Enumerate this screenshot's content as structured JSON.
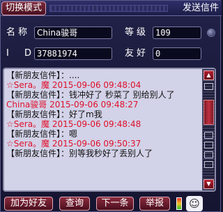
{
  "header": {
    "mode_button": "切换模式",
    "send_label": "发送信件"
  },
  "info": {
    "name_label": "名称",
    "name_value": "China骏哥",
    "level_label": "等级",
    "level_value": "109",
    "id_label": "I D",
    "id_value": "37881974",
    "friend_label": "友好",
    "friend_value": "0"
  },
  "messages": [
    {
      "text": "【新朋友信件】：....",
      "color": "black"
    },
    {
      "text": "☆Sera。魔 2015-09-06 09:48:04",
      "color": "red"
    },
    {
      "text": "【新朋友信件】：钱冲好了 秒菜了  别给别人了",
      "color": "black",
      "wrap": true
    },
    {
      "text": "China骏哥 2015-09-06 09:48:27",
      "color": "red"
    },
    {
      "text": "【新朋友信件】：好了m我",
      "color": "black"
    },
    {
      "text": "☆Sera。魔 2015-09-06 09:48:48",
      "color": "red"
    },
    {
      "text": "【新朋友信件】：嗯",
      "color": "black"
    },
    {
      "text": "☆Sera。魔 2015-09-06 09:50:37",
      "color": "red"
    },
    {
      "text": "【新朋友信件】：别等我秒好了丢别人了",
      "color": "black",
      "wrap": true
    }
  ],
  "buttons": {
    "add_friend": "加为好友",
    "query": "查询",
    "next": "下一条",
    "report": "举报"
  },
  "icons": {
    "scroll_up": "up-arrow-icon",
    "scroll_down": "down-arrow-icon",
    "meter": "signal-meter-icon",
    "face": "emoticon-icon"
  },
  "colors": {
    "accent_button": "#7a2b3d",
    "message_red": "#e0102a",
    "panel_bg": "#d2d2e8"
  }
}
